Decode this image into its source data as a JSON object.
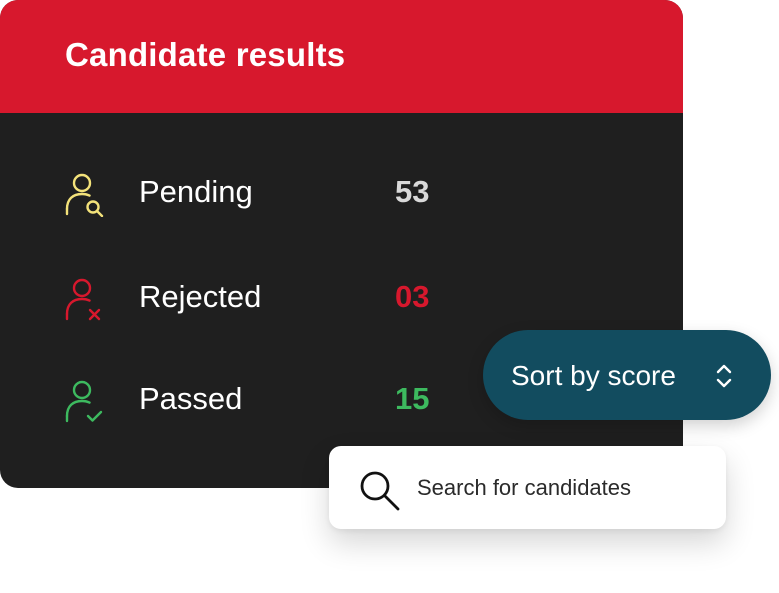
{
  "card": {
    "title": "Candidate results"
  },
  "rows": [
    {
      "label": "Pending",
      "count": "53",
      "icon": "user-search-icon",
      "color": "#f3e27a"
    },
    {
      "label": "Rejected",
      "count": "03",
      "icon": "user-x-icon",
      "color": "#d7182d"
    },
    {
      "label": "Passed",
      "count": "15",
      "icon": "user-check-icon",
      "color": "#3dba5f"
    }
  ],
  "sort": {
    "label": "Sort by score",
    "icon": "chevron-up-down-icon"
  },
  "search": {
    "placeholder": "Search for candidates",
    "icon": "search-icon"
  },
  "colors": {
    "header": "#d7182d",
    "card_bg": "#1f1f1f",
    "sort_bg": "#124c5f"
  }
}
